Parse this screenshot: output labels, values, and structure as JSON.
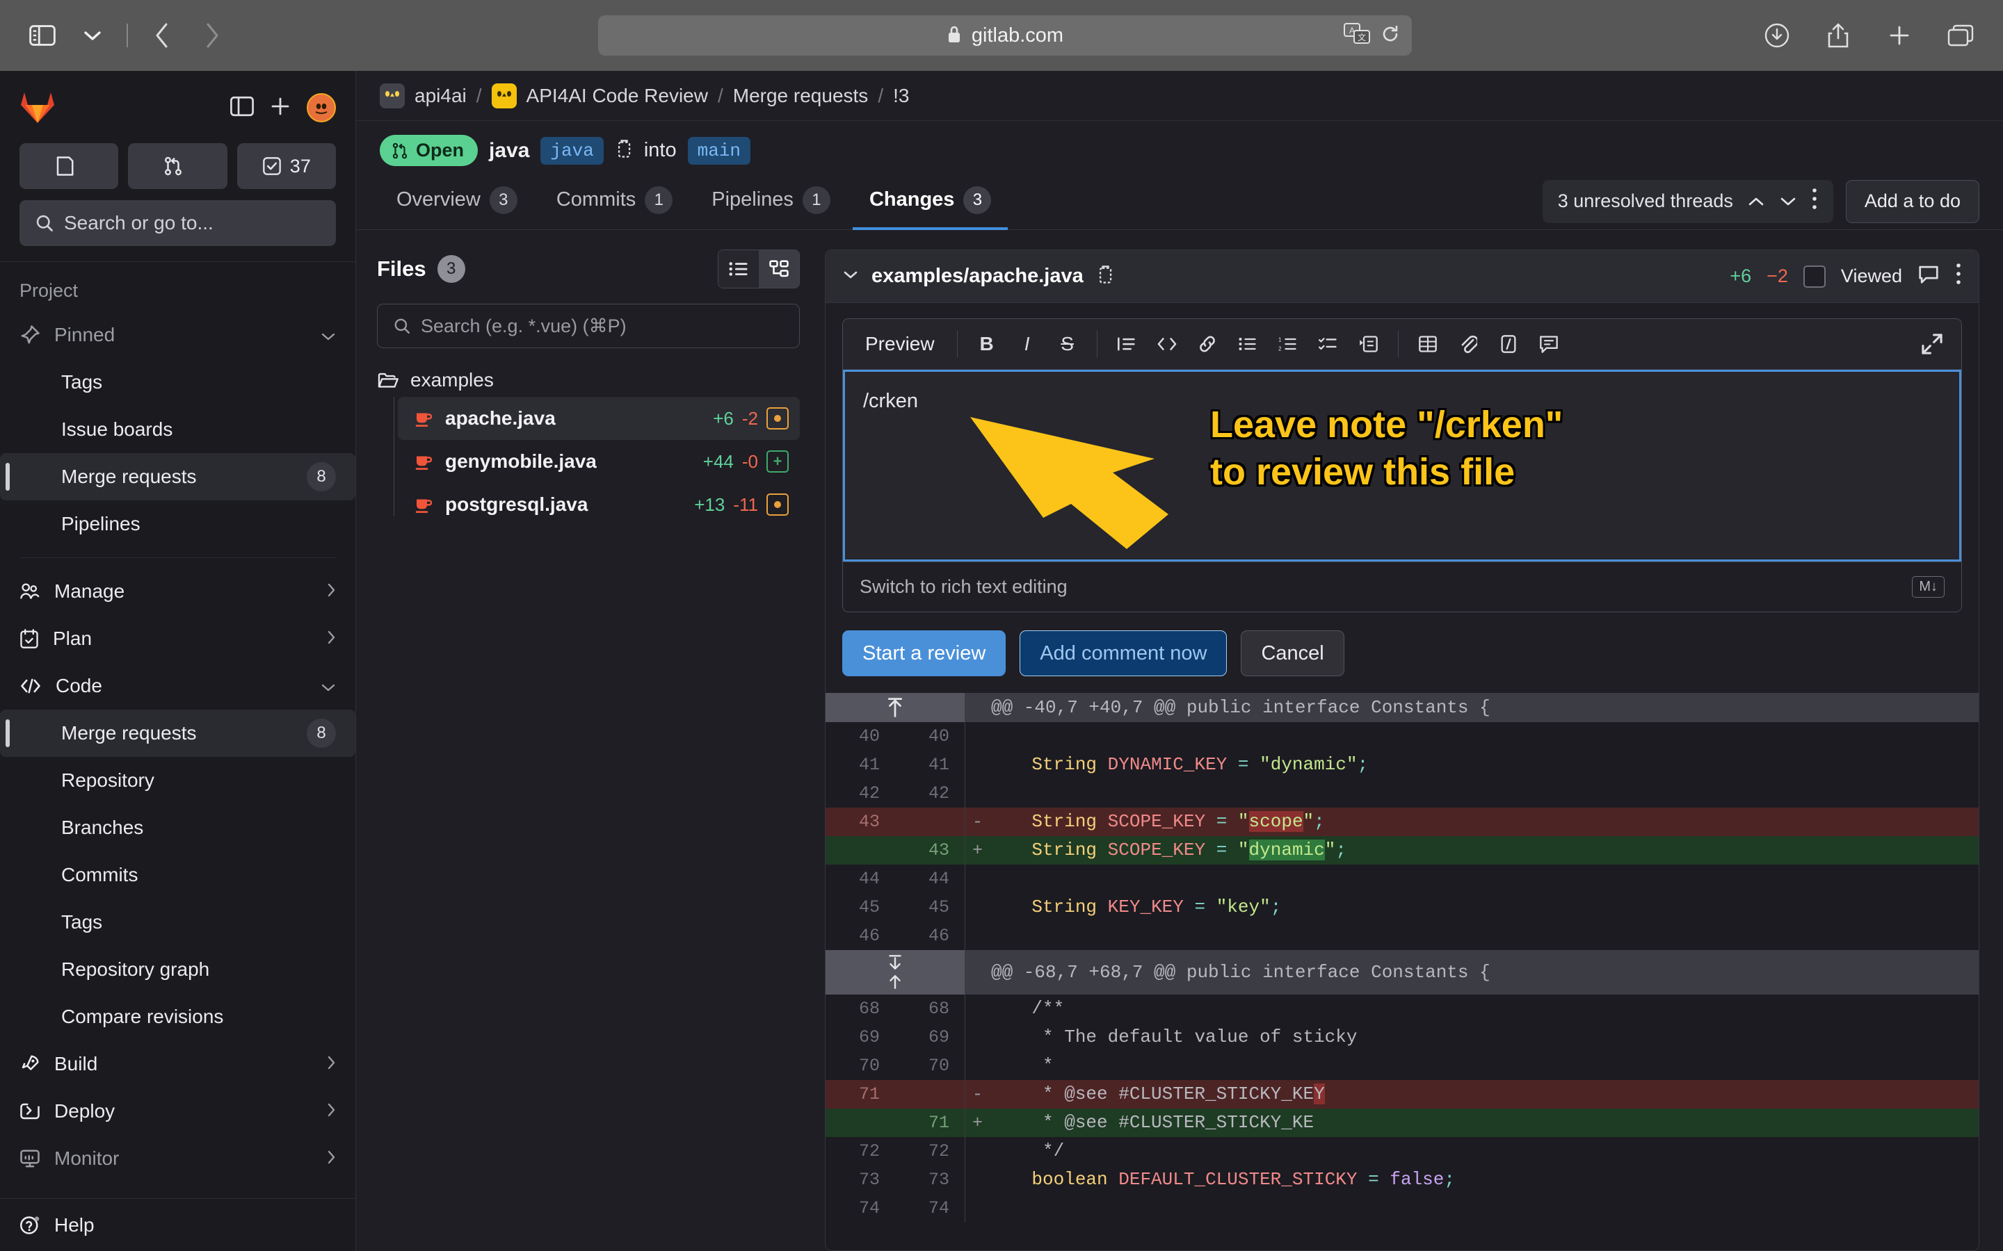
{
  "browser": {
    "url": "gitlab.com",
    "icons": {
      "sidebar_toggle": "sidebar-toggle-icon",
      "tab_overview": "chevron-down-icon",
      "back": "back-arrow-icon",
      "forward": "forward-arrow-icon",
      "lock": "lock-icon",
      "translate": "translate-icon",
      "reload": "reload-icon",
      "download": "download-icon",
      "share": "share-icon",
      "new_tab": "plus-icon",
      "tabs": "tab-overview-icon"
    }
  },
  "sidebar": {
    "logo": "gitlab-logo-icon",
    "panel_toggle_label": "panel-toggle-icon",
    "create_new_label": "plus-icon",
    "avatar_label": "user-avatar",
    "quick_buttons": [
      {
        "icon": "issues-icon",
        "count": ""
      },
      {
        "icon": "merge-request-icon",
        "count": ""
      },
      {
        "icon": "todo-icon",
        "count": "37"
      }
    ],
    "search_placeholder": "Search or go to...",
    "section_label": "Project",
    "pinned_label": "Pinned",
    "items": [
      {
        "label": "Tags",
        "count": "",
        "sub": true
      },
      {
        "label": "Issue boards",
        "count": "",
        "sub": true
      },
      {
        "label": "Merge requests",
        "count": "8",
        "sub": true,
        "active": true
      },
      {
        "label": "Pipelines",
        "count": "",
        "sub": true
      }
    ],
    "groups": [
      {
        "label": "Manage",
        "icon": "users-icon"
      },
      {
        "label": "Plan",
        "icon": "calendar-icon"
      },
      {
        "label": "Code",
        "icon": "code-icon",
        "expanded": true
      }
    ],
    "code_items": [
      {
        "label": "Merge requests",
        "count": "8",
        "active": true
      },
      {
        "label": "Repository",
        "count": ""
      },
      {
        "label": "Branches",
        "count": ""
      },
      {
        "label": "Commits",
        "count": ""
      },
      {
        "label": "Tags",
        "count": ""
      },
      {
        "label": "Repository graph",
        "count": ""
      },
      {
        "label": "Compare revisions",
        "count": ""
      }
    ],
    "groups_bottom": [
      {
        "label": "Build",
        "icon": "rocket-icon"
      },
      {
        "label": "Deploy",
        "icon": "deploy-icon"
      },
      {
        "label": "Monitor",
        "icon": "monitor-icon"
      }
    ],
    "help_label": "Help"
  },
  "breadcrumb": {
    "group": "api4ai",
    "project": "API4AI Code Review",
    "section": "Merge requests",
    "id": "!3"
  },
  "mr": {
    "status_label": "Open",
    "source_branch": "java",
    "source_chip": "java",
    "into_label": "into",
    "target_chip": "main",
    "copy_icon": "copy-branch-icon"
  },
  "tabs": [
    {
      "label": "Overview",
      "count": "3",
      "active": false
    },
    {
      "label": "Commits",
      "count": "1",
      "active": false
    },
    {
      "label": "Pipelines",
      "count": "1",
      "active": false
    },
    {
      "label": "Changes",
      "count": "3",
      "active": true
    }
  ],
  "toolbar": {
    "threads_label": "3 unresolved threads",
    "todo_label": "Add a to do"
  },
  "files_pane": {
    "title": "Files",
    "count": "3",
    "search_placeholder": "Search (e.g. *.vue) (⌘P)",
    "folder": "examples",
    "files": [
      {
        "name": "apache.java",
        "added": "+6",
        "removed": "-2",
        "badge": "mod",
        "selected": true
      },
      {
        "name": "genymobile.java",
        "added": "+44",
        "removed": "-0",
        "badge": "add",
        "selected": false
      },
      {
        "name": "postgresql.java",
        "added": "+13",
        "removed": "-11",
        "badge": "mod",
        "selected": false
      }
    ]
  },
  "diff": {
    "filename": "examples/apache.java",
    "added": "+6",
    "removed": "−2",
    "viewed_label": "Viewed",
    "editor": {
      "preview_label": "Preview",
      "value": "/crken",
      "footer_label": "Switch to rich text editing",
      "md_badge": "M↓",
      "toolbar_icons": [
        "bold-icon",
        "italic-icon",
        "strikethrough-icon",
        "quote-icon",
        "code-icon",
        "link-icon",
        "bullet-list-icon",
        "numbered-list-icon",
        "task-list-icon",
        "collapsible-icon",
        "table-icon",
        "attach-icon",
        "slash-command-icon",
        "comment-template-icon"
      ],
      "expand_icon": "expand-icon"
    },
    "actions": {
      "start_review": "Start a review",
      "add_comment": "Add comment now",
      "cancel": "Cancel"
    },
    "hunks": [
      {
        "header": "@@ -40,7 +40,7 @@ public interface Constants {",
        "expand": "up",
        "lines": [
          {
            "old": "40",
            "new": "40",
            "sign": "",
            "type": "ctx",
            "code": ""
          },
          {
            "old": "41",
            "new": "41",
            "sign": "",
            "type": "ctx",
            "code": "    String DYNAMIC_KEY = \"dynamic\";"
          },
          {
            "old": "42",
            "new": "42",
            "sign": "",
            "type": "ctx",
            "code": ""
          },
          {
            "old": "43",
            "new": "",
            "sign": "-",
            "type": "del",
            "code": "    String SCOPE_KEY = \"scope\";"
          },
          {
            "old": "",
            "new": "43",
            "sign": "+",
            "type": "ins",
            "code": "    String SCOPE_KEY = \"dynamic\";"
          },
          {
            "old": "44",
            "new": "44",
            "sign": "",
            "type": "ctx",
            "code": ""
          },
          {
            "old": "45",
            "new": "45",
            "sign": "",
            "type": "ctx",
            "code": "    String KEY_KEY = \"key\";"
          },
          {
            "old": "46",
            "new": "46",
            "sign": "",
            "type": "ctx",
            "code": ""
          }
        ]
      },
      {
        "header": "@@ -68,7 +68,7 @@ public interface Constants {",
        "expand": "both",
        "lines": [
          {
            "old": "68",
            "new": "68",
            "sign": "",
            "type": "ctx",
            "code": "    /**"
          },
          {
            "old": "69",
            "new": "69",
            "sign": "",
            "type": "ctx",
            "code": "     * The default value of sticky"
          },
          {
            "old": "70",
            "new": "70",
            "sign": "",
            "type": "ctx",
            "code": "     *"
          },
          {
            "old": "71",
            "new": "",
            "sign": "-",
            "type": "del",
            "code": "     * @see #CLUSTER_STICKY_KEY"
          },
          {
            "old": "",
            "new": "71",
            "sign": "+",
            "type": "ins",
            "code": "     * @see #CLUSTER_STICKY_KE"
          },
          {
            "old": "72",
            "new": "72",
            "sign": "",
            "type": "ctx",
            "code": "     */"
          },
          {
            "old": "73",
            "new": "73",
            "sign": "",
            "type": "ctx",
            "code": "    boolean DEFAULT_CLUSTER_STICKY = false;"
          },
          {
            "old": "74",
            "new": "74",
            "sign": "",
            "type": "ctx",
            "code": ""
          }
        ]
      }
    ]
  },
  "annotation": {
    "text": "Leave note \"/crken\"\nto review this file",
    "color": "#fcc419"
  }
}
